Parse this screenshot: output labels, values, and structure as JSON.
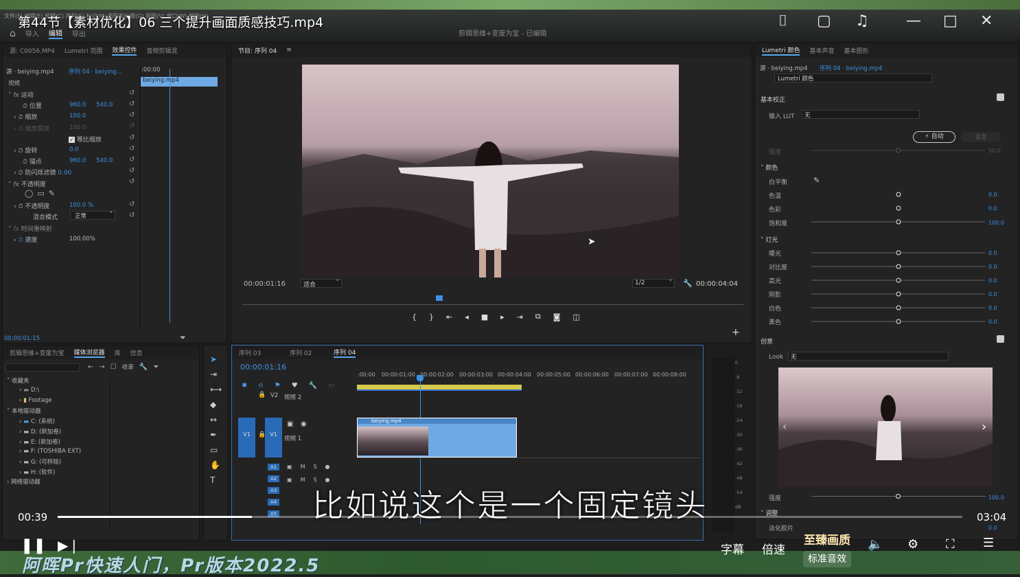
{
  "video": {
    "title": "第44节【素材优化】06 三个提升画面质感技巧.mp4",
    "subtitle": "比如说这个是一个固定镜头",
    "current_time": "00:39",
    "total_time": "03:04",
    "progress_pct": 21.5,
    "watermark": "阿晖Pr快速人门，Pr版本2022.5",
    "controls": {
      "caption": "字幕",
      "speed": "倍速",
      "quality": "至臻画质",
      "audio_effect": "标准音效"
    }
  },
  "premiere": {
    "menu": "文件(F)  编辑(E)  剪辑(C)  序列(S)  标记(M)  图形和标题(G)  视图(V)  窗口(W)  帮助(H)",
    "workspaces": [
      "导入",
      "编辑",
      "导出"
    ],
    "project_title": "剪辑思维+变废为宝 - 已编辑",
    "effect_controls": {
      "tabs": [
        "源: C0056.MP4",
        "Lumetri 范围",
        "效果控件",
        "音频剪辑混"
      ],
      "source": "源 · beiying.mp4",
      "sequence": "序列 04 · beiying...",
      "timecode_header": ":00:00",
      "clip": "beiying.mp4",
      "section": "视频",
      "motion": "运动",
      "position": "位置",
      "pos_x": "960.0",
      "pos_y": "540.0",
      "scale": "缩放",
      "scale_val": "100.0",
      "scale_w": "缩放宽度",
      "scale_w_val": "100.0",
      "uniform": "等比缩放",
      "rotation": "旋转",
      "rot_val": "0.0",
      "anchor": "锚点",
      "anc_x": "960.0",
      "anc_y": "540.0",
      "flicker": "防闪烁滤镜",
      "flicker_val": "0.00",
      "opacity_group": "不透明度",
      "opacity": "不透明度",
      "opacity_val": "100.0 %",
      "blend": "混合模式",
      "blend_val": "正常",
      "time_remap": "时间重映射",
      "speed": "速度",
      "speed_val": "100.00%",
      "timecode": "00:00:01:15"
    },
    "program": {
      "tab": "节目: 序列 04",
      "timecode": "00:00:01:16",
      "fit": "适合",
      "quality": "1/2",
      "duration": "00:00:04:04"
    },
    "lumetri": {
      "tabs": [
        "Lumetri 颜色",
        "基本声音",
        "基本图形"
      ],
      "source": "源 · beiying.mp4",
      "sequence": "序列 04 · beiying.mp4",
      "effect": "Lumetri 颜色",
      "basic": "基本校正",
      "input_lut": "输入 LUT",
      "lut_val": "无",
      "auto": "自动",
      "reset": "重置",
      "intensity": "强度",
      "intensity_val": "50.0",
      "color": "颜色",
      "white_balance": "白平衡",
      "temp": "色温",
      "tint": "色彩",
      "saturation": "饱和度",
      "light": "灯光",
      "exposure": "曝光",
      "contrast": "对比度",
      "highlights": "高光",
      "shadows": "阴影",
      "whites": "白色",
      "blacks": "黑色",
      "zero": "0.0",
      "hundred": "100.0",
      "creative": "创意",
      "look": "Look",
      "look_val": "无",
      "cr_intensity": "强度",
      "adjust": "调整",
      "faded": "淡化胶片"
    },
    "project": {
      "tabs": [
        "剪辑思维+变废为宝",
        "媒体浏览器",
        "库",
        "信息"
      ],
      "favorites": "收藏夹",
      "fav_d": "D:\\",
      "fav_footage": "Footage",
      "local": "本地驱动器",
      "drives": [
        "C: (系统)",
        "D: (新加卷)",
        "E: (新加卷)",
        "F: (TOSHIBA EXT)",
        "G: (可移除)",
        "H: (软件)"
      ],
      "network": "网络驱动器",
      "collect": "收录"
    },
    "timeline": {
      "tabs": [
        "序列 03",
        "序列 02",
        "序列 04"
      ],
      "timecode": "00:00:01:16",
      "ruler": [
        ":00:00",
        "00:00:01:00",
        "00:00:02:00",
        "00:00:03:00",
        "00:00:04:00",
        "00:00:05:00",
        "00:00:06:00",
        "00:00:07:00",
        "00:00:08:00"
      ],
      "v2": "V2",
      "v2_name": "视频 2",
      "v1": "V1",
      "v1_name": "视频 1",
      "clip": "beiying.mp4",
      "audio": [
        "A1",
        "A2",
        "A3",
        "A4",
        "A5"
      ],
      "meter": [
        "0",
        "-6",
        "-12",
        "-18",
        "-24",
        "-30",
        "-36",
        "-42",
        "-48",
        "-54",
        "dB"
      ]
    }
  }
}
